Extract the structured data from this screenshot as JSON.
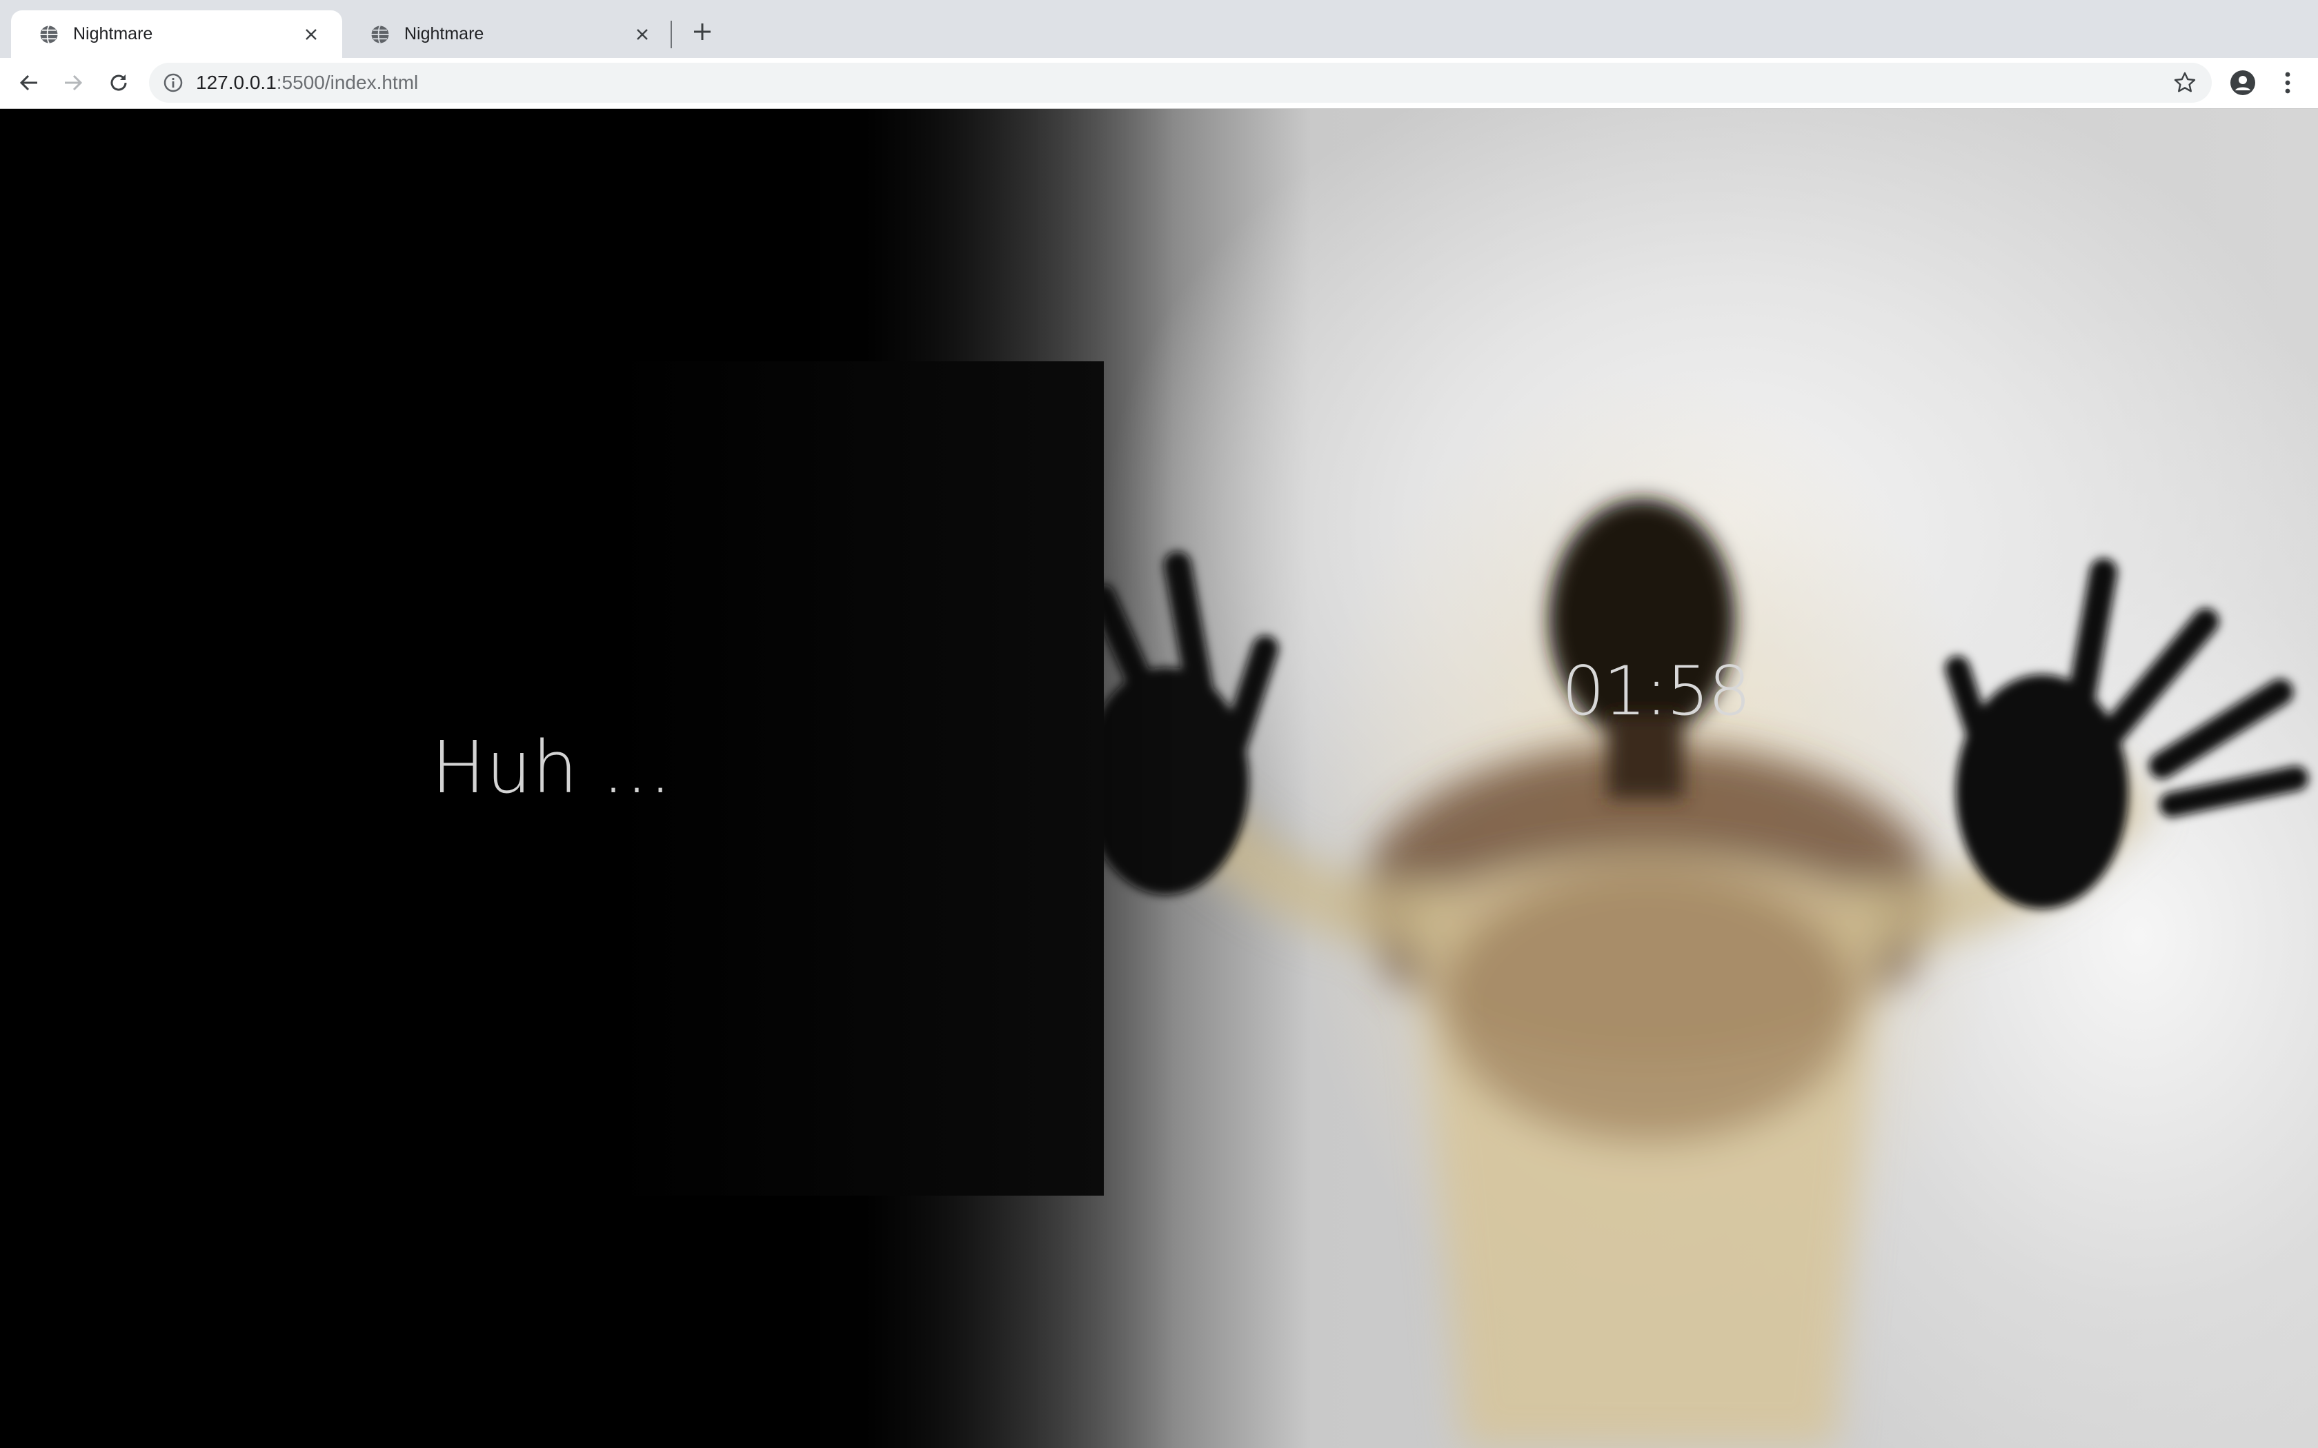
{
  "browser": {
    "tabs": [
      {
        "title": "Nightmare",
        "active": true,
        "icon": "globe-icon"
      },
      {
        "title": "Nightmare",
        "active": false,
        "icon": "globe-icon"
      }
    ],
    "url_host": "127.0.0.1",
    "url_rest": ":5500/index.html"
  },
  "page": {
    "panel_text": "Huh ...",
    "timer": "01:58"
  },
  "colors": {
    "tab_strip": "#dee1e6",
    "page_text": "#d4d4d4",
    "panel": "#000000"
  }
}
